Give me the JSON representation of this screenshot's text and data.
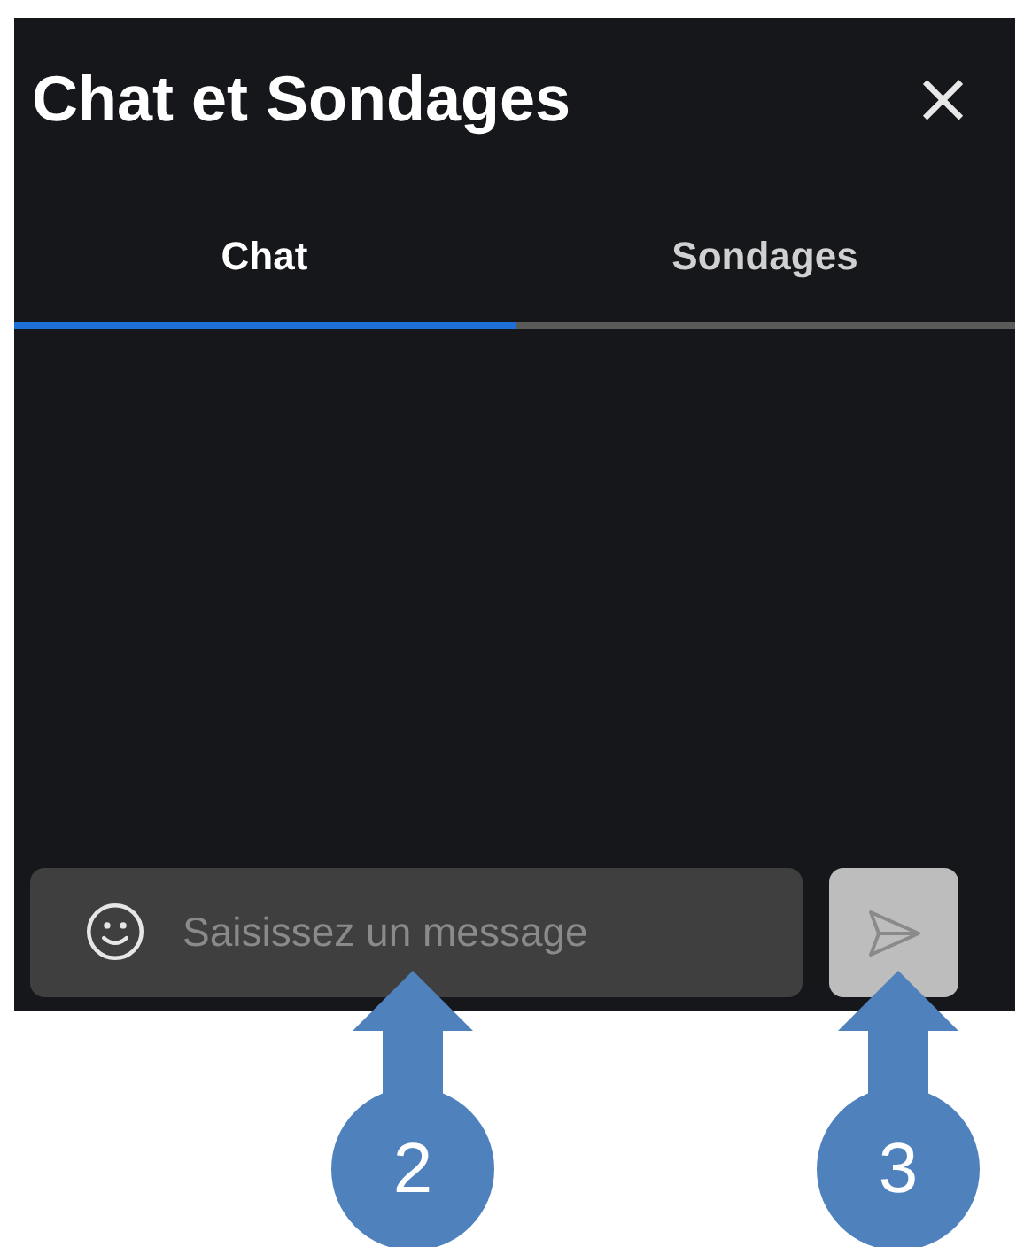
{
  "panel": {
    "title": "Chat et Sondages",
    "close": "×"
  },
  "tabs": [
    {
      "label": "Chat",
      "selected": true
    },
    {
      "label": "Sondages",
      "selected": false
    }
  ],
  "composer": {
    "placeholder": "Saisissez un message",
    "send_disabled": true
  },
  "callouts": [
    "2",
    "3"
  ]
}
